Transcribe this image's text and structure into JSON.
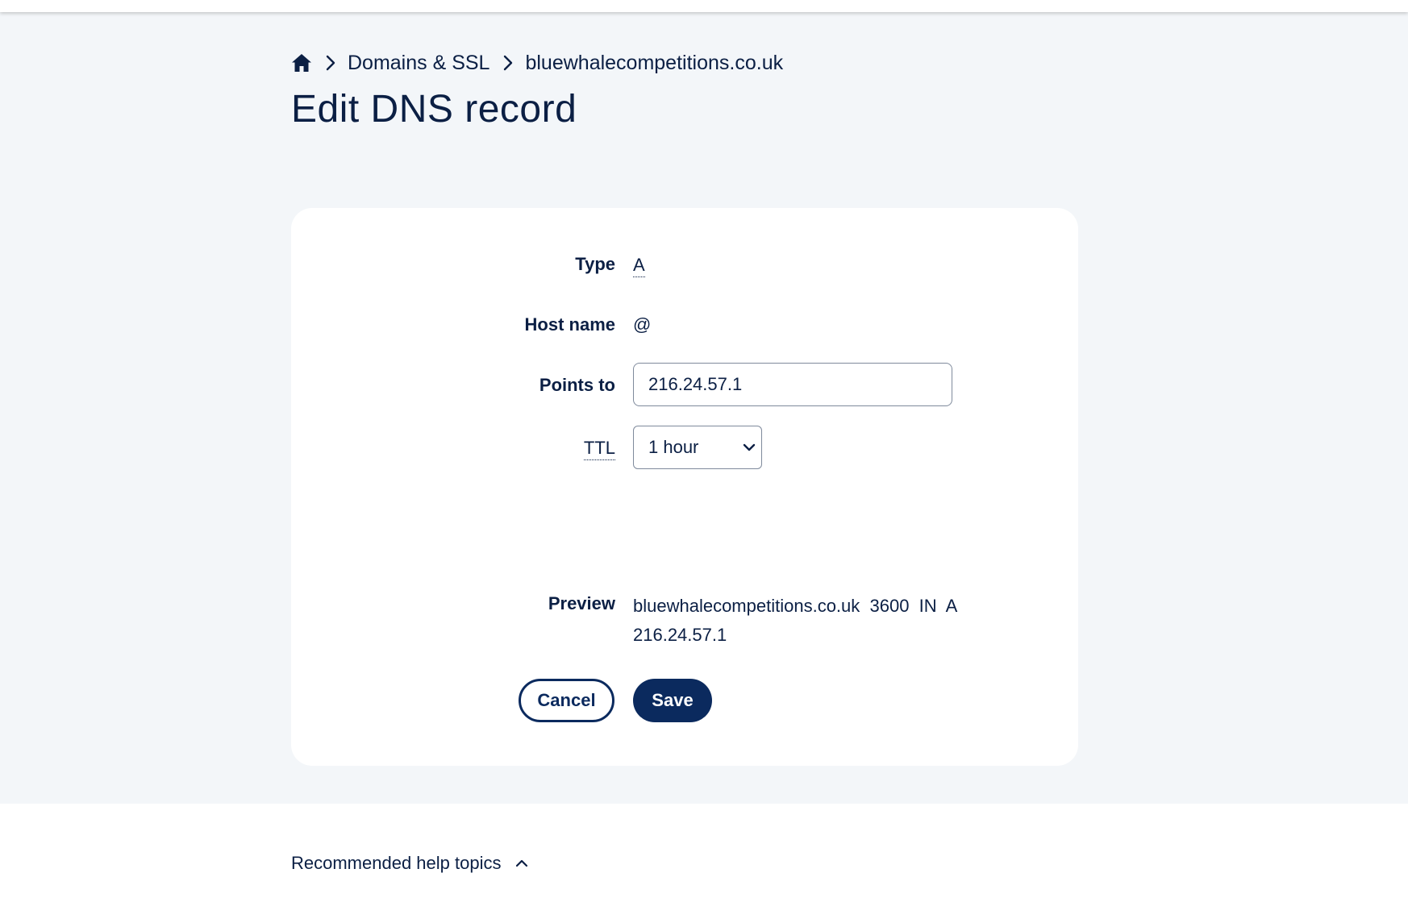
{
  "breadcrumb": {
    "home_icon": "home-icon",
    "items": [
      "Domains & SSL",
      "bluewhalecompetitions.co.uk"
    ]
  },
  "page": {
    "title": "Edit DNS record"
  },
  "form": {
    "type_label": "Type",
    "type_value": "A",
    "host_label": "Host name",
    "host_value": "@",
    "points_label": "Points to",
    "points_value": "216.24.57.1",
    "ttl_label": "TTL",
    "ttl_selected": "1 hour",
    "preview_label": "Preview",
    "preview_value": "bluewhalecompetitions.co.uk  3600  IN  A 216.24.57.1"
  },
  "actions": {
    "cancel_label": "Cancel",
    "save_label": "Save"
  },
  "help": {
    "label": "Recommended help topics",
    "icon": "chevron-up-icon"
  },
  "colors": {
    "text": "#0b1f44",
    "primary": "#0b2a5e",
    "page_bg": "#f3f6f9",
    "card_bg": "#ffffff"
  }
}
